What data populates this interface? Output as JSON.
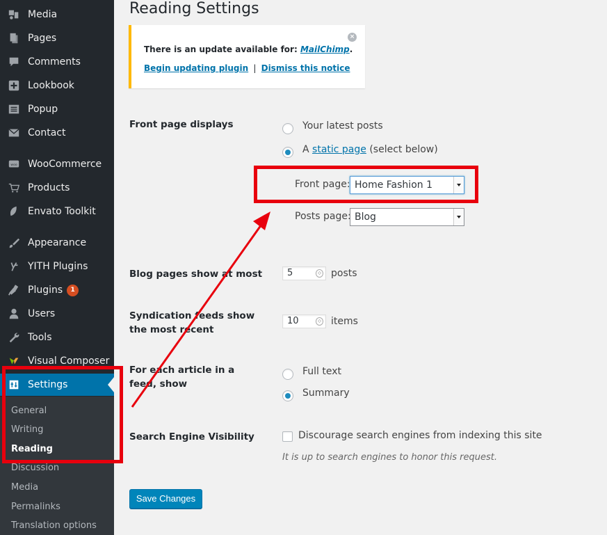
{
  "sidebar": {
    "items": [
      {
        "label": "Media",
        "icon": "media-icon"
      },
      {
        "label": "Pages",
        "icon": "pages-icon"
      },
      {
        "label": "Comments",
        "icon": "comments-icon"
      },
      {
        "label": "Lookbook",
        "icon": "plus-square-icon"
      },
      {
        "label": "Popup",
        "icon": "list-icon"
      },
      {
        "label": "Contact",
        "icon": "envelope-icon"
      },
      {
        "label": "WooCommerce",
        "icon": "woo-icon"
      },
      {
        "label": "Products",
        "icon": "cart-icon"
      },
      {
        "label": "Envato Toolkit",
        "icon": "leaf-icon"
      },
      {
        "label": "Appearance",
        "icon": "brush-icon"
      },
      {
        "label": "YITH Plugins",
        "icon": "yith-icon"
      },
      {
        "label": "Plugins",
        "icon": "plug-icon",
        "badge": "1"
      },
      {
        "label": "Users",
        "icon": "user-icon"
      },
      {
        "label": "Tools",
        "icon": "wrench-icon"
      },
      {
        "label": "Visual Composer",
        "icon": "vc-icon"
      },
      {
        "label": "Settings",
        "icon": "settings-icon",
        "active": true
      }
    ],
    "submenu": [
      "General",
      "Writing",
      "Reading",
      "Discussion",
      "Media",
      "Permalinks",
      "Translation options"
    ],
    "submenu_current": "Reading"
  },
  "page": {
    "title": "Reading Settings"
  },
  "notice": {
    "text_prefix": "There is an update available for: ",
    "plugin_name": "MailChimp",
    "text_suffix": ".",
    "update_link": "Begin updating plugin",
    "separator": "|",
    "dismiss_link": "Dismiss this notice",
    "close_symbol": "×"
  },
  "front_page": {
    "label": "Front page displays",
    "option_latest": "Your latest posts",
    "option_static_prefix": "A ",
    "option_static_link": "static page",
    "option_static_suffix": " (select below)",
    "selected": "static",
    "front_label": "Front page:",
    "front_value": "Home Fashion 1",
    "posts_label": "Posts page:",
    "posts_value": "Blog"
  },
  "blog_pages": {
    "label": "Blog pages show at most",
    "value": "5",
    "unit": "posts"
  },
  "syndication": {
    "label": "Syndication feeds show the most recent",
    "value": "10",
    "unit": "items"
  },
  "feed_article": {
    "label": "For each article in a feed, show",
    "option_full": "Full text",
    "option_summary": "Summary",
    "selected": "summary"
  },
  "search_visibility": {
    "label": "Search Engine Visibility",
    "checkbox_label": "Discourage search engines from indexing this site",
    "checked": false,
    "description": "It is up to search engines to honor this request."
  },
  "buttons": {
    "save": "Save Changes"
  },
  "colors": {
    "sidebar_bg": "#23282d",
    "submenu_bg": "#32373c",
    "active_bg": "#0073aa",
    "link": "#0073aa",
    "notice_border": "#ffb900",
    "button": "#0085ba",
    "annotation": "#e8000d"
  }
}
